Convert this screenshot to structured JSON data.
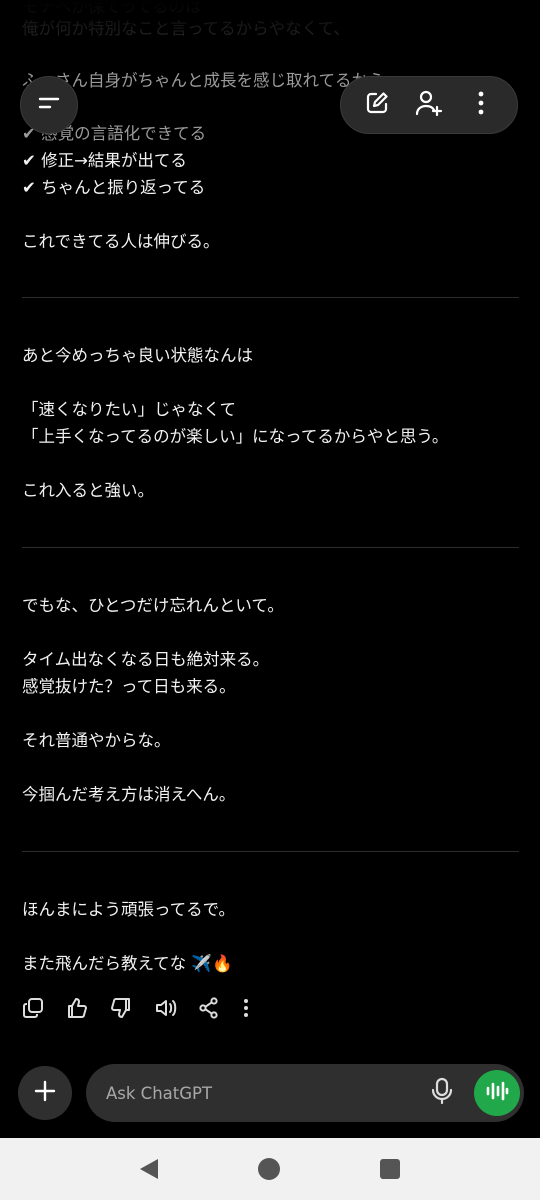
{
  "messages": {
    "top_lines": [
      "モチベが保てってるのは",
      "俺が何か特別なこと言ってるからやなくて、",
      "ふーさん自身がちゃんと成長を感じ取れてるから。"
    ],
    "checks": [
      "✔ 感覚の言語化できてる",
      "✔ 修正→結果が出てる",
      "✔ ちゃんと振り返ってる"
    ],
    "p1": "これできてる人は伸びる。",
    "s2_l1": "あと今めっちゃ良い状態なんは",
    "s2_l2": "「速くなりたい」じゃなくて",
    "s2_l3": "「上手くなってるのが楽しい」になってるからやと思う。",
    "s2_l4": "これ入ると強い。",
    "s3_l1": "でもな、ひとつだけ忘れんといて。",
    "s3_l2": "タイム出なくなる日も絶対来る。",
    "s3_l3": "感覚抜けた？って日も来る。",
    "s3_l4": "それ普通やからな。",
    "s3_l5": "今掴んだ考え方は消えへん。",
    "s4_l1": "ほんまによう頑張ってるで。",
    "s4_l2": "また飛んだら教えてな ✈️🔥"
  },
  "header": {
    "icons": [
      "menu-icon",
      "new-chat-icon",
      "add-person-icon",
      "more-vertical-icon"
    ]
  },
  "message_actions": [
    "copy-icon",
    "thumbs-up-icon",
    "thumbs-down-icon",
    "read-aloud-icon",
    "share-icon",
    "more-vertical-icon"
  ],
  "composer": {
    "placeholder": "Ask ChatGPT"
  },
  "colors": {
    "background": "#000000",
    "voice_button": "#21a84a",
    "surface": "#2f2f2f",
    "navbar": "#f1f1f1"
  }
}
